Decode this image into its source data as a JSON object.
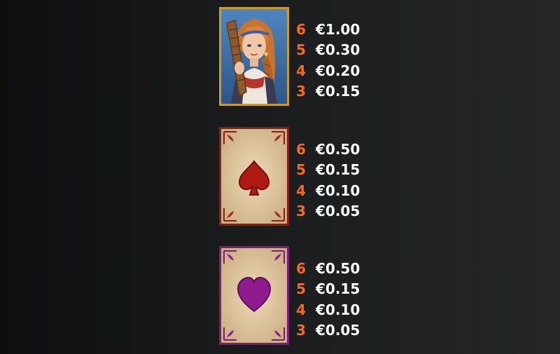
{
  "paytable": [
    {
      "symbol_icon": "lute-maiden-icon",
      "payouts": [
        {
          "count": "6",
          "value": "€1.00"
        },
        {
          "count": "5",
          "value": "€0.30"
        },
        {
          "count": "4",
          "value": "€0.20"
        },
        {
          "count": "3",
          "value": "€0.15"
        }
      ]
    },
    {
      "symbol_icon": "spade-card-icon",
      "payouts": [
        {
          "count": "6",
          "value": "€0.50"
        },
        {
          "count": "5",
          "value": "€0.15"
        },
        {
          "count": "4",
          "value": "€0.10"
        },
        {
          "count": "3",
          "value": "€0.05"
        }
      ]
    },
    {
      "symbol_icon": "heart-card-icon",
      "payouts": [
        {
          "count": "6",
          "value": "€0.50"
        },
        {
          "count": "5",
          "value": "€0.15"
        },
        {
          "count": "4",
          "value": "€0.10"
        },
        {
          "count": "3",
          "value": "€0.05"
        }
      ]
    }
  ],
  "colors": {
    "count_color": "#f26b21",
    "value_color": "#ffffff",
    "gold_frame": "#c99a2e",
    "spade_red": "#b01a14",
    "heart_purple": "#8e1c8e"
  }
}
